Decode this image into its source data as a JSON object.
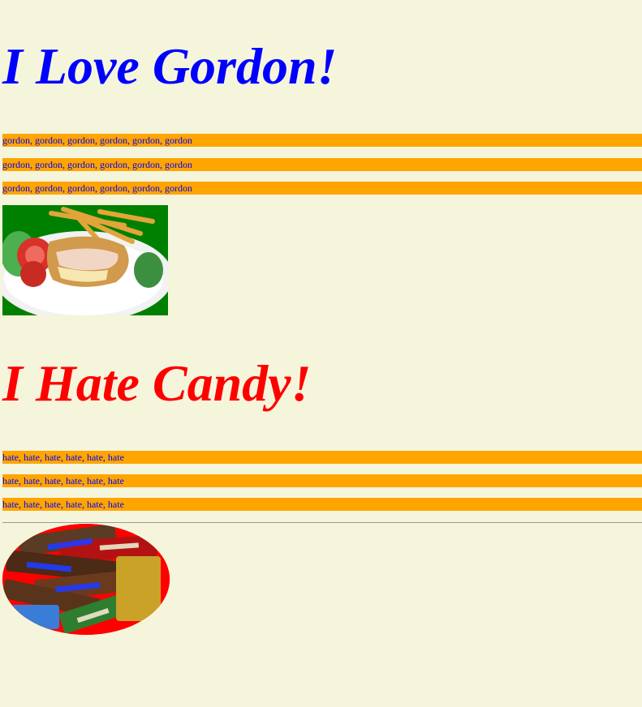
{
  "gordon_section": {
    "heading": "I Love Gordon!",
    "lines": [
      "gordon, gordon, gordon, gordon, gordon, gordon",
      "gordon, gordon, gordon, gordon, gordon, gordon",
      "gordon, gordon, gordon, gordon, gordon, gordon"
    ],
    "image": {
      "label": "chicken-cordon-bleu-plate-image",
      "bg": "#008000"
    }
  },
  "candy_section": {
    "heading": "I Hate Candy!",
    "lines": [
      "hate, hate, hate, hate, hate, hate",
      "hate, hate, hate, hate, hate, hate",
      "hate, hate, hate, hate, hate, hate"
    ],
    "image": {
      "label": "candy-bars-image",
      "bg": "#ff0000"
    }
  },
  "colors": {
    "page_bg": "#f5f5dc",
    "bar_bg": "#ffa500",
    "love_heading": "#0000ff",
    "hate_heading": "#ff0000",
    "bar_text": "#0000ff"
  }
}
